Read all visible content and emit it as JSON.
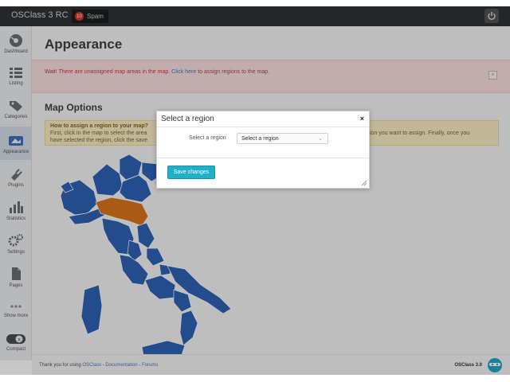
{
  "app": {
    "brand": "OSClass 3 RC",
    "spam_count": "10",
    "spam_label": "Spam"
  },
  "sidebar": {
    "items": [
      {
        "label": "Dashboard",
        "icon": "dashboard-icon"
      },
      {
        "label": "Listing",
        "icon": "list-icon"
      },
      {
        "label": "Categories",
        "icon": "tag-icon"
      },
      {
        "label": "Appearance",
        "icon": "paint-icon",
        "active": true
      },
      {
        "label": "Plugins",
        "icon": "plug-icon"
      },
      {
        "label": "Statistics",
        "icon": "bar-chart-icon"
      },
      {
        "label": "Settings",
        "icon": "gear-icon"
      },
      {
        "label": "Pages",
        "icon": "page-icon"
      },
      {
        "label": "Show more",
        "icon": "more-icon"
      },
      {
        "label": "Compact",
        "icon": "toggle-icon"
      }
    ]
  },
  "main": {
    "title": "Appearance",
    "alert": {
      "prefix": "Wait! There are unassigned map areas in the map.",
      "link": "Click here",
      "suffix": "to assign regions to the map."
    },
    "section_title": "Map Options",
    "help": {
      "title": "How to assign a region to your map?",
      "line1": "First, click in the map to select the area",
      "line2": "have selected the region, click the save",
      "line1_right": "ion you want to assign. Finally, once you"
    }
  },
  "dialog": {
    "title": "Select a region",
    "close": "×",
    "field_label": "Select a region",
    "select_value": "Select a region",
    "save_label": "Save changes"
  },
  "footer": {
    "prefix": "Thank you for using",
    "link1": "OSClass",
    "sep1": "-",
    "link2": "Documentation",
    "sep2": "-",
    "link3": "Forums",
    "version": "OSClass 3.0"
  },
  "colors": {
    "map_blue": "#2e62b4",
    "map_selected": "#d9741a",
    "accent_button": "#21b0c8",
    "alert_text": "#c53b3b"
  }
}
